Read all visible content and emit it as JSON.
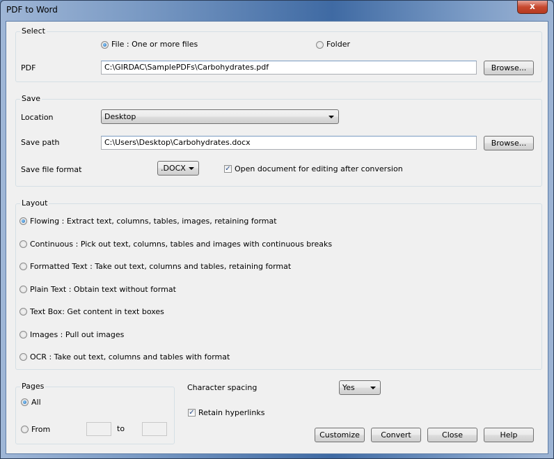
{
  "window": {
    "title": "PDF to Word",
    "close_label": "x"
  },
  "select_group": {
    "label": "Select",
    "file_radio": {
      "label": "File :  One or more files",
      "checked": true
    },
    "folder_radio": {
      "label": "Folder",
      "checked": false
    },
    "pdf_label": "PDF",
    "pdf_value": "C:\\GIRDAC\\SamplePDFs\\Carbohydrates.pdf",
    "browse_label": "Browse..."
  },
  "save_group": {
    "label": "Save",
    "location_label": "Location",
    "location_value": "Desktop",
    "save_path_label": "Save path",
    "save_path_value": "C:\\Users\\Desktop\\Carbohydrates.docx",
    "browse_label": "Browse...",
    "format_label": "Save file format",
    "format_value": ".DOCX",
    "open_doc_label": "Open document for editing after conversion",
    "open_doc_checked": true
  },
  "layout_group": {
    "label": "Layout",
    "options": [
      {
        "label": "Flowing :  Extract text, columns, tables, images, retaining format",
        "checked": true
      },
      {
        "label": "Continuous :  Pick out text, columns, tables and images with continuous breaks",
        "checked": false
      },
      {
        "label": "Formatted Text :  Take out text, columns and tables, retaining format",
        "checked": false
      },
      {
        "label": "Plain Text :  Obtain text without format",
        "checked": false
      },
      {
        "label": "Text Box: Get content in text boxes",
        "checked": false
      },
      {
        "label": "Images :  Pull out images",
        "checked": false
      },
      {
        "label": "OCR :  Take out text, columns and tables with format",
        "checked": false
      }
    ]
  },
  "pages_group": {
    "label": "Pages",
    "all_label": "All",
    "all_checked": true,
    "from_label": "From",
    "from_value": "",
    "to_label": "to",
    "to_value": ""
  },
  "options": {
    "char_spacing_label": "Character spacing",
    "char_spacing_value": "Yes",
    "retain_hyperlinks_label": "Retain hyperlinks",
    "retain_hyperlinks_checked": true
  },
  "buttons": {
    "customize": "Customize",
    "convert": "Convert",
    "close": "Close",
    "help": "Help"
  }
}
